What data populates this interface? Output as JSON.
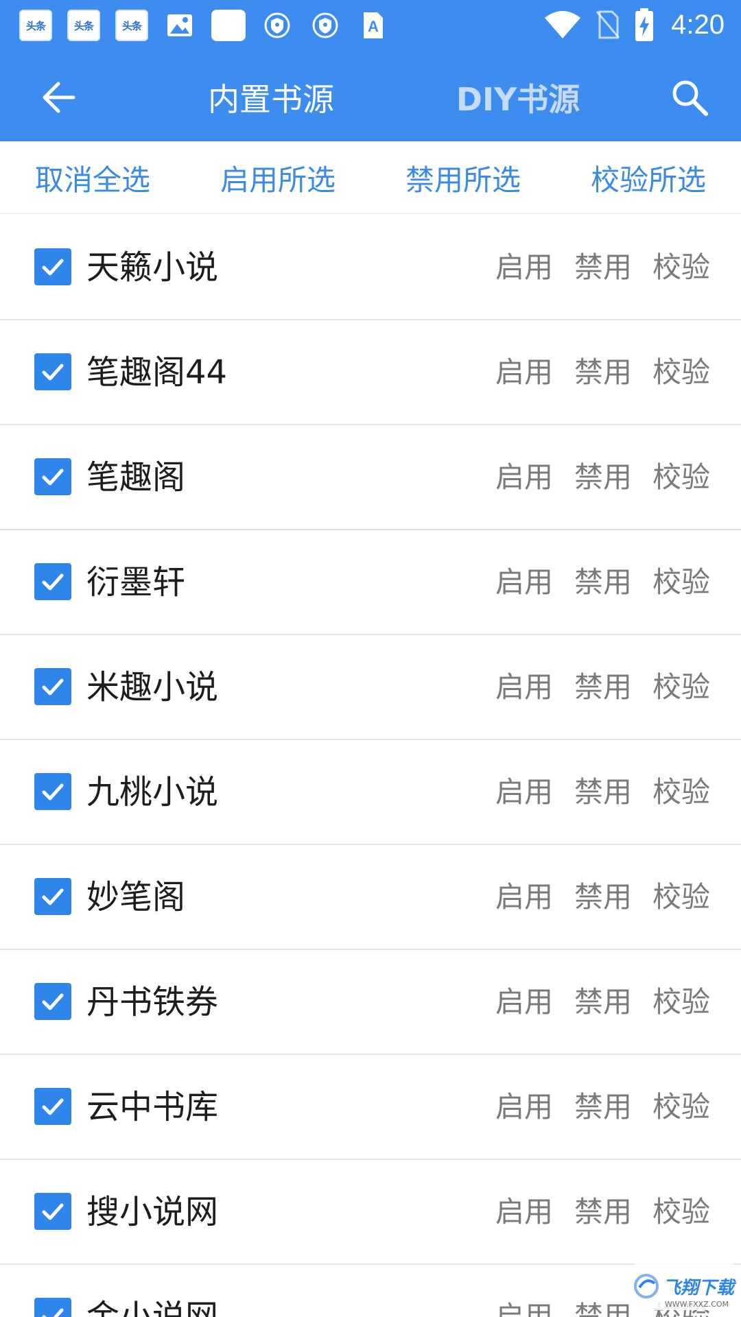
{
  "status_bar": {
    "notif_app_label": "头条",
    "vpn_letter": "A",
    "time": "4:20"
  },
  "app_bar": {
    "tab_builtin": "内置书源",
    "tab_diy": "DIY书源"
  },
  "actions": {
    "deselect_all": "取消全选",
    "enable_selected": "启用所选",
    "disable_selected": "禁用所选",
    "verify_selected": "校验所选"
  },
  "row_actions": {
    "enable": "启用",
    "disable": "禁用",
    "verify": "校验"
  },
  "sources": [
    {
      "name": "天籁小说",
      "checked": true
    },
    {
      "name": "笔趣阁44",
      "checked": true
    },
    {
      "name": "笔趣阁",
      "checked": true
    },
    {
      "name": "衍墨轩",
      "checked": true
    },
    {
      "name": "米趣小说",
      "checked": true
    },
    {
      "name": "九桃小说",
      "checked": true
    },
    {
      "name": "妙笔阁",
      "checked": true
    },
    {
      "name": "丹书铁券",
      "checked": true
    },
    {
      "name": "云中书库",
      "checked": true
    },
    {
      "name": "搜小说网",
      "checked": true
    },
    {
      "name": "金小说网",
      "checked": true
    }
  ],
  "watermark": {
    "text": "飞翔下载",
    "url": "WWW.FXXZ.COM"
  },
  "colors": {
    "primary": "#3d8df0",
    "accent": "#2f86ea",
    "action_text": "#3a8ae6",
    "row_action_text": "#7a7a7a"
  }
}
